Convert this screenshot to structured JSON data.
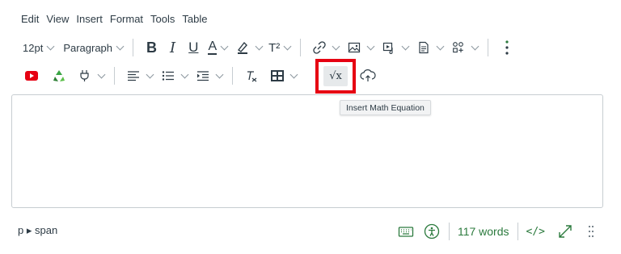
{
  "menu": [
    "Edit",
    "View",
    "Insert",
    "Format",
    "Tools",
    "Table"
  ],
  "toolbar": {
    "font_size": "12pt",
    "block_format": "Paragraph",
    "bold": "B",
    "italic": "I",
    "underline": "U",
    "text_color": "A",
    "superscript": "T²",
    "math_symbol": "√x"
  },
  "tooltip": "Insert Math Equation",
  "status": {
    "path": "p ▸ span",
    "word_count": "117 words",
    "html_toggle": "</>"
  },
  "colors": {
    "highlight": "#e60012",
    "accent_green": "#2b7a3d",
    "youtube_red": "#e60012"
  }
}
